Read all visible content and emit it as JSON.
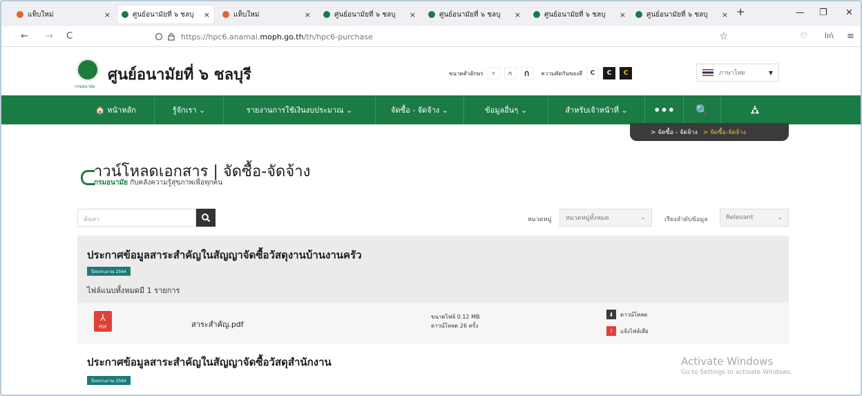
{
  "browser": {
    "tabs": [
      {
        "label": "แท็บใหม่",
        "active": false,
        "icon": "firefox-icon"
      },
      {
        "label": "ศูนย์อนามัยที่ ๖ ชลบุ",
        "active": true,
        "icon": "site-icon"
      },
      {
        "label": "แท็บใหม่",
        "active": false,
        "icon": "firefox-icon"
      },
      {
        "label": "ศูนย์อนามัยที่ ๖ ชลบุ",
        "active": false,
        "icon": "site-icon"
      },
      {
        "label": "ศูนย์อนามัยที่ ๖ ชลบุ",
        "active": false,
        "icon": "site-icon"
      },
      {
        "label": "ศูนย์อนามัยที่ ๖ ชลบุ",
        "active": false,
        "icon": "site-icon"
      },
      {
        "label": "ศูนย์อนามัยที่ ๖ ชลบุ",
        "active": false,
        "icon": "site-icon"
      }
    ],
    "tab_close": "×",
    "new_tab": "+",
    "window_controls": {
      "minimize": "—",
      "restore": "❐",
      "close": "✕"
    },
    "nav": {
      "back": "←",
      "forward": "→",
      "reload": "C"
    },
    "url": {
      "prefix": "https://hpc6.anamai.",
      "domain": "moph.go.th",
      "path": "/th/hpc6-purchase"
    },
    "toolbar_icons": {
      "star": "☆",
      "pocket": "♡",
      "library": "lıı\\",
      "menu": "≡"
    }
  },
  "site": {
    "logo_caption": "กรมอนามัย",
    "title": "ศูนย์อนามัยที่ ๖ ชลบุรี",
    "font_size_label": "ขนาดตัวอักษร",
    "font_size_buttons": [
      "ก",
      "ก",
      "ก"
    ],
    "contrast_label": "ความคัดกันของสี",
    "contrast_buttons": [
      {
        "label": "C",
        "bg": "#ffffff",
        "fg": "#333333"
      },
      {
        "label": "C",
        "bg": "#1a1a1a",
        "fg": "#ffffff"
      },
      {
        "label": "C",
        "bg": "#1a1a1a",
        "fg": "#f5d200"
      }
    ],
    "language": "ภาษาไทย",
    "accent": "#1b7b45"
  },
  "menu": {
    "items": [
      {
        "label": "🏠 หน้าหลัก"
      },
      {
        "label": "รู้จักเรา ⌄"
      },
      {
        "label": "รายงานการใช้เงินงบประมาณ ⌄"
      },
      {
        "label": "จัดซื้อ - จัดจ้าง ⌄"
      },
      {
        "label": "ข้อมูลอื่นๆ ⌄"
      },
      {
        "label": "สำหรับเจ้าหน้าที่ ⌄"
      },
      {
        "label": "•••"
      },
      {
        "label": "🔍"
      },
      {
        "label": "⛼"
      }
    ]
  },
  "breadcrumb": {
    "parent": "> จัดซื้อ - จัดจ้าง",
    "current": "> จัดซื้อ-จัดจ้าง"
  },
  "page": {
    "title": "าวน์โหลดเอกสาร | จัดซื้อ-จัดจ้าง",
    "subtitle_brand": "กรมอนามัย",
    "subtitle_rest": " กับคลังความรู้สุขภาพเพื่อทุกคน"
  },
  "filters": {
    "search_placeholder": "ค้นหา",
    "category_label": "หมวดหมู่",
    "category_value": "หมวดหมู่ทั้งหมด",
    "sort_label": "เรียงลำดับข้อมูล",
    "sort_value": "Relevant"
  },
  "blocks": [
    {
      "title": "ประกาศข้อมูลสาระสำคัญในสัญญาจัดซื้อวัสดุงานบ้านงานครัว",
      "badge": "ปีงบประมาณ 2564",
      "count": "ไฟล์แนบทั้งหมดมี 1 รายการ",
      "file": {
        "icon_label": "PDF",
        "name": "สาระสำคัญ.pdf",
        "size": "ขนาดไฟล์ 0.12 MB",
        "downloads": "ดาวน์โหลด 26 ครั้ง",
        "download_label": "ดาวน์โหลด",
        "report_label": "แจ้งไฟล์เสีย"
      }
    },
    {
      "title": "ประกาศข้อมูลสาระสำคัญในสัญญาจัดซื้อวัสดุสำนักงาน",
      "badge": "ปีงบประมาณ 2564"
    }
  ],
  "watermark": {
    "line1": "Activate Windows",
    "line2": "Go to Settings to activate Windows."
  }
}
